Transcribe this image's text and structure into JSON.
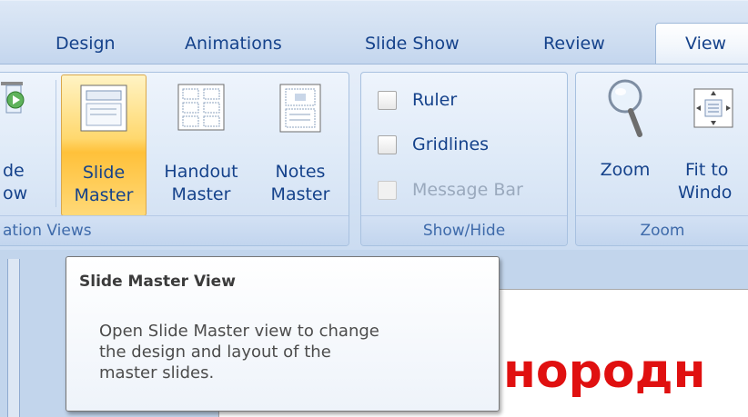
{
  "tabs": [
    {
      "label": "Design"
    },
    {
      "label": "Animations"
    },
    {
      "label": "Slide Show"
    },
    {
      "label": "Review"
    },
    {
      "label": "View",
      "selected": true
    }
  ],
  "groups": {
    "presentation_views": {
      "label_partial": "ation Views",
      "partial_button": {
        "line1": "de",
        "line2": "ow"
      },
      "slide_master": {
        "line1": "Slide",
        "line2": "Master",
        "icon": "slide-master-icon",
        "state": "hover"
      },
      "handout_master": {
        "line1": "Handout",
        "line2": "Master",
        "icon": "handout-master-icon"
      },
      "notes_master": {
        "line1": "Notes",
        "line2": "Master",
        "icon": "notes-master-icon"
      }
    },
    "show_hide": {
      "label": "Show/Hide",
      "ruler": {
        "label": "Ruler",
        "checked": false
      },
      "gridlines": {
        "label": "Gridlines",
        "checked": false
      },
      "message_bar": {
        "label": "Message Bar",
        "checked": false,
        "disabled": true
      }
    },
    "zoom": {
      "label": "Zoom",
      "zoom": {
        "label": "Zoom",
        "icon": "magnifier-icon"
      },
      "fit_to_window": {
        "line1": "Fit to",
        "line2": "Windo",
        "icon": "fit-to-window-icon"
      }
    }
  },
  "tooltip": {
    "title": "Slide Master View",
    "lines": [
      "Open Slide Master view to change",
      "the design and layout of the",
      "master slides."
    ]
  },
  "slide": {
    "visible_text": "нородн",
    "text_color": "#e01010"
  },
  "colors": {
    "accent_hover": "#ffc13a",
    "tab_text": "#15428b",
    "ribbon_bg": "#dbe7f6"
  }
}
